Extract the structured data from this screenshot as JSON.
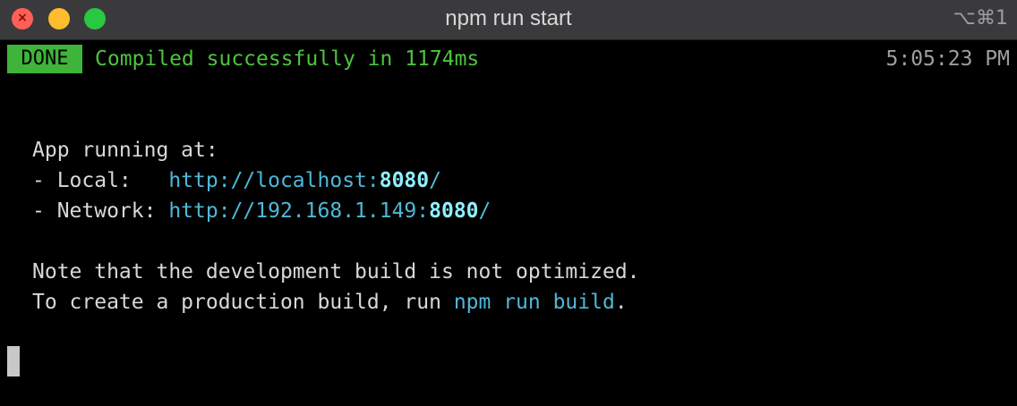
{
  "window": {
    "title": "npm run start",
    "shortcut": "⌥⌘1"
  },
  "status": {
    "badge": "DONE",
    "message": "Compiled successfully in 1174ms",
    "time": "5:05:23 PM"
  },
  "app": {
    "heading": "App running at:",
    "local_label": "- Local:   ",
    "local_url_prefix": "http://localhost:",
    "local_port": "8080",
    "local_url_suffix": "/",
    "network_label": "- Network: ",
    "network_url_prefix": "http://192.168.1.149:",
    "network_port": "8080",
    "network_url_suffix": "/"
  },
  "notes": {
    "line1": "Note that the development build is not optimized.",
    "line2_prefix": "To create a production build, run ",
    "line2_command": "npm run build",
    "line2_suffix": "."
  },
  "colors": {
    "success": "#4cc43d",
    "badge_bg": "#3fb43a",
    "url": "#4fb8d8",
    "port": "#8ff0ff",
    "text": "#d8d8d8"
  }
}
